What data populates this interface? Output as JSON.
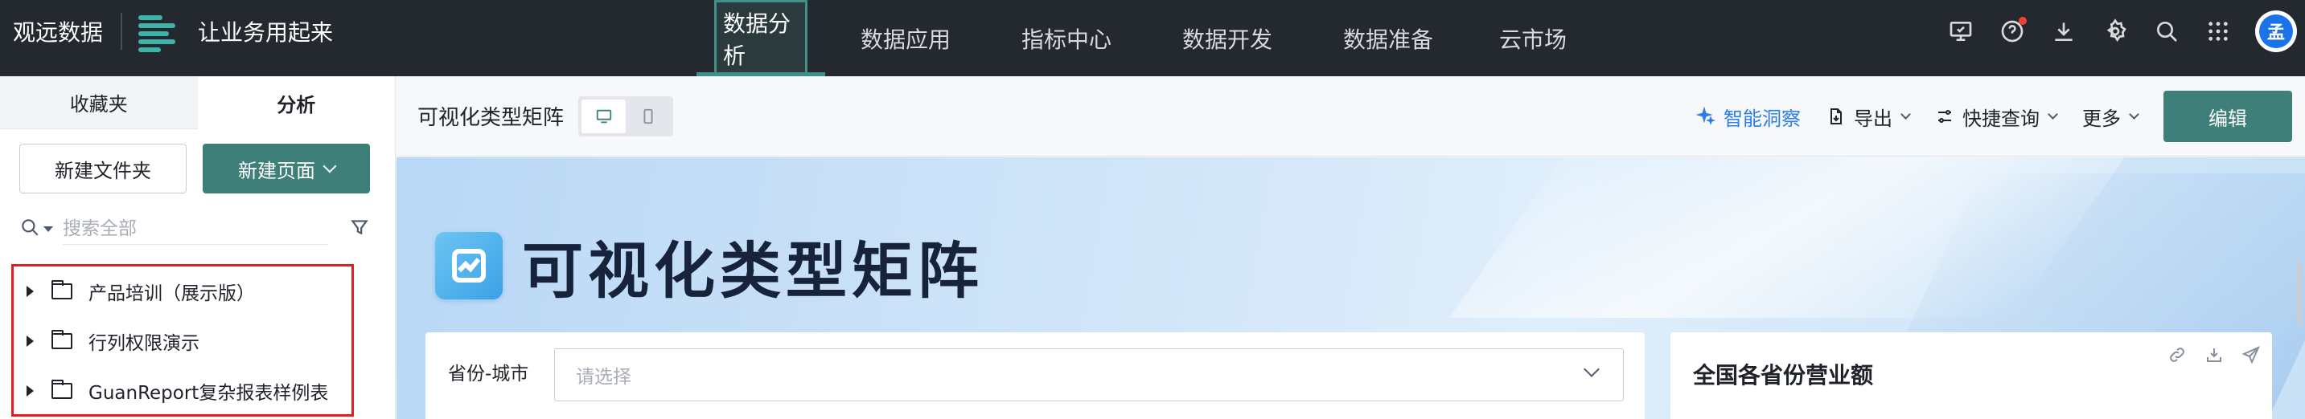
{
  "brand": {
    "name": "观远数据",
    "slogan": "让业务用起来"
  },
  "nav": {
    "items": [
      {
        "label": "数据分析",
        "active": true
      },
      {
        "label": "数据应用"
      },
      {
        "label": "指标中心"
      },
      {
        "label": "数据开发"
      },
      {
        "label": "数据准备"
      },
      {
        "label": "云市场"
      }
    ]
  },
  "top_icons": [
    "monitor-icon",
    "help-icon",
    "download-icon",
    "settings-icon",
    "search-icon",
    "apps-grid-icon"
  ],
  "user": {
    "avatar_text": "孟"
  },
  "sidebar": {
    "tabs": [
      {
        "label": "收藏夹"
      },
      {
        "label": "分析",
        "active": true
      }
    ],
    "new_folder": "新建文件夹",
    "new_page": "新建页面",
    "search_placeholder": "搜索全部",
    "tree": [
      {
        "label": "产品培训（展示版）"
      },
      {
        "label": "行列权限演示"
      },
      {
        "label": "GuanReport复杂报表样例表"
      }
    ]
  },
  "toolbar": {
    "page_name": "可视化类型矩阵",
    "ai": "智能洞察",
    "export": "导出",
    "quick_query": "快捷查询",
    "more": "更多",
    "edit": "编辑"
  },
  "report": {
    "title": "可视化类型矩阵",
    "filter_label": "省份-城市",
    "filter_placeholder": "请选择",
    "chart_title": "全国各省份营业额"
  },
  "colors": {
    "topbar": "#23292e",
    "accent": "#3f7f7a",
    "ai_blue": "#2e7ee6",
    "highlight_border": "#e02020"
  }
}
